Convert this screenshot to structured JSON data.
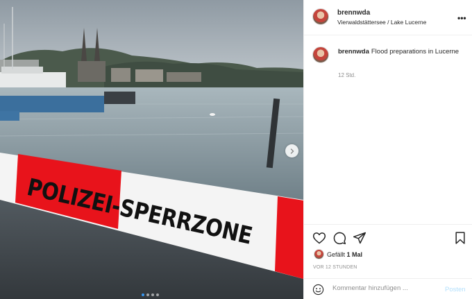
{
  "post": {
    "username": "brennwda",
    "location": "Vierwaldstättersee / Lake Lucerne",
    "more_icon": "more-options-icon",
    "more_glyph": "•••",
    "photo": {
      "tape_text": "POLIZEI-SPERRZONE",
      "carousel": {
        "slides": 4,
        "active_index": 0
      }
    },
    "caption": {
      "username": "brennwda",
      "text": "Flood preparations in Lucerne",
      "time": "12 Std."
    },
    "actions": {
      "like_icon": "heart-icon",
      "comment_icon": "comment-icon",
      "share_icon": "share-icon",
      "save_icon": "bookmark-icon"
    },
    "likes": {
      "prefix": "Gefällt",
      "count_label": "1 Mal"
    },
    "posted": "VOR 12 STUNDEN",
    "comment": {
      "placeholder": "Kommentar hinzufügen ...",
      "post_label": "Posten",
      "emoji_icon": "smiley-icon"
    },
    "colors": {
      "tape_red": "#e8131b",
      "accent_blue": "#3897f0",
      "post_disabled": "#b2dffc",
      "text": "#262626",
      "muted": "#8e8e8e"
    }
  }
}
